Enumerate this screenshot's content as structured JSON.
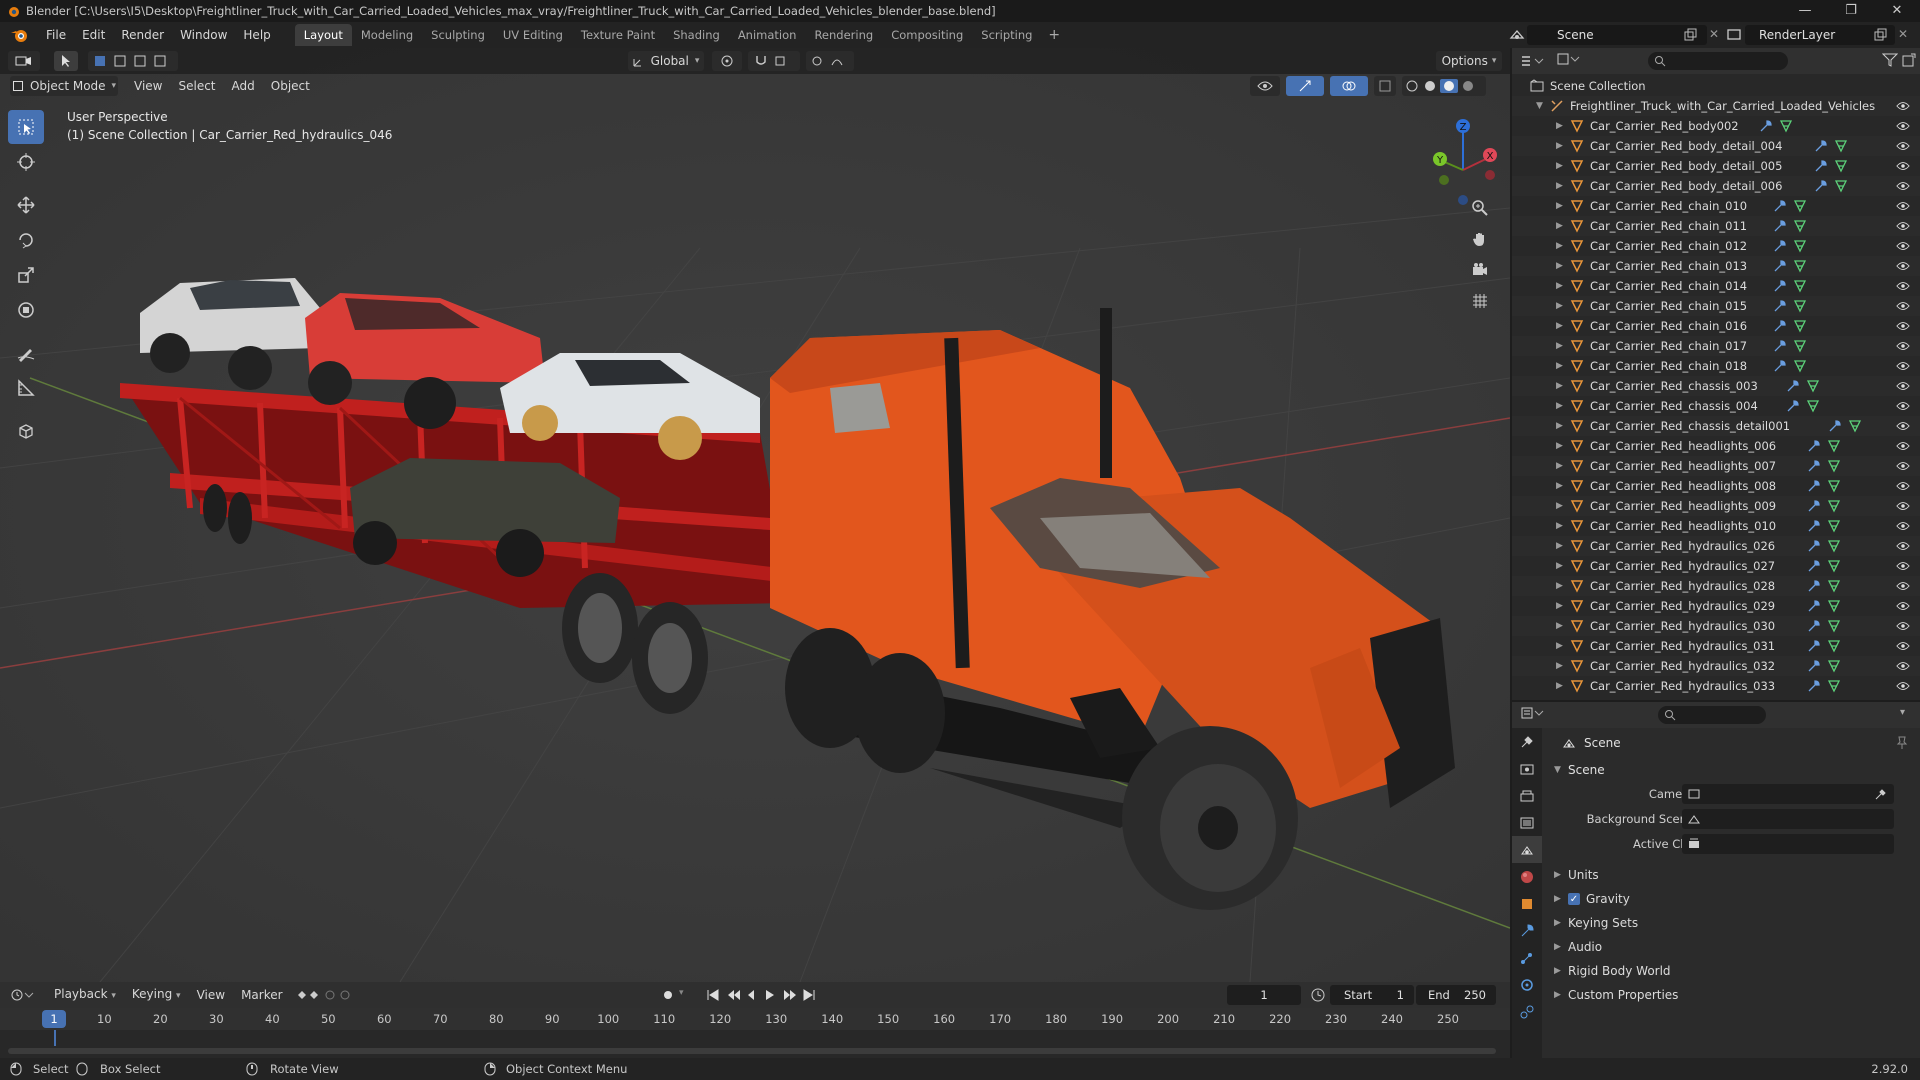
{
  "window": {
    "title": "Blender [C:\\Users\\I5\\Desktop\\Freightliner_Truck_with_Car_Carried_Loaded_Vehicles_max_vray/Freightliner_Truck_with_Car_Carried_Loaded_Vehicles_blender_base.blend]",
    "minimize": "—",
    "maximize": "❐",
    "close": "✕"
  },
  "menu": [
    "File",
    "Edit",
    "Render",
    "Window",
    "Help"
  ],
  "workspaces": [
    "Layout",
    "Modeling",
    "Sculpting",
    "UV Editing",
    "Texture Paint",
    "Shading",
    "Animation",
    "Rendering",
    "Compositing",
    "Scripting"
  ],
  "workspace_add": "+",
  "scene_field": "Scene",
  "renderlayer_field": "RenderLayer",
  "viewport": {
    "mode": "Object Mode",
    "menus": [
      "View",
      "Select",
      "Add",
      "Object"
    ],
    "orientation": "Global",
    "options": "Options",
    "info_line1": "User Perspective",
    "info_line2": "(1) Scene Collection | Car_Carrier_Red_hydraulics_046",
    "gizmo": {
      "z": "Z",
      "y": "Y",
      "x": "X"
    }
  },
  "outliner": {
    "root": "Scene Collection",
    "collection": "Freightliner_Truck_with_Car_Carried_Loaded_Vehicles",
    "items": [
      "Car_Carrier_Red_body002",
      "Car_Carrier_Red_body_detail_004",
      "Car_Carrier_Red_body_detail_005",
      "Car_Carrier_Red_body_detail_006",
      "Car_Carrier_Red_chain_010",
      "Car_Carrier_Red_chain_011",
      "Car_Carrier_Red_chain_012",
      "Car_Carrier_Red_chain_013",
      "Car_Carrier_Red_chain_014",
      "Car_Carrier_Red_chain_015",
      "Car_Carrier_Red_chain_016",
      "Car_Carrier_Red_chain_017",
      "Car_Carrier_Red_chain_018",
      "Car_Carrier_Red_chassis_003",
      "Car_Carrier_Red_chassis_004",
      "Car_Carrier_Red_chassis_detail001",
      "Car_Carrier_Red_headlights_006",
      "Car_Carrier_Red_headlights_007",
      "Car_Carrier_Red_headlights_008",
      "Car_Carrier_Red_headlights_009",
      "Car_Carrier_Red_headlights_010",
      "Car_Carrier_Red_hydraulics_026",
      "Car_Carrier_Red_hydraulics_027",
      "Car_Carrier_Red_hydraulics_028",
      "Car_Carrier_Red_hydraulics_029",
      "Car_Carrier_Red_hydraulics_030",
      "Car_Carrier_Red_hydraulics_031",
      "Car_Carrier_Red_hydraulics_032",
      "Car_Carrier_Red_hydraulics_033"
    ]
  },
  "properties": {
    "context": "Scene",
    "panel": "Scene",
    "fields": [
      {
        "label": "Camera"
      },
      {
        "label": "Background Scene"
      },
      {
        "label": "Active Clip"
      }
    ],
    "subpanels": [
      "Units",
      "Gravity",
      "Keying Sets",
      "Audio",
      "Rigid Body World",
      "Custom Properties"
    ],
    "gravity_checked": true
  },
  "timeline": {
    "menus": [
      "Playback",
      "Keying",
      "View",
      "Marker"
    ],
    "current_frame": "1",
    "start_label": "Start",
    "start": "1",
    "end_label": "End",
    "end": "250",
    "ticks": [
      "1",
      "10",
      "20",
      "30",
      "40",
      "50",
      "60",
      "70",
      "80",
      "90",
      "100",
      "110",
      "120",
      "130",
      "140",
      "150",
      "160",
      "170",
      "180",
      "190",
      "200",
      "210",
      "220",
      "230",
      "240",
      "250"
    ]
  },
  "status": {
    "select": "Select",
    "box_select": "Box Select",
    "rotate": "Rotate View",
    "context_menu": "Object Context Menu",
    "version": "2.92.0"
  }
}
